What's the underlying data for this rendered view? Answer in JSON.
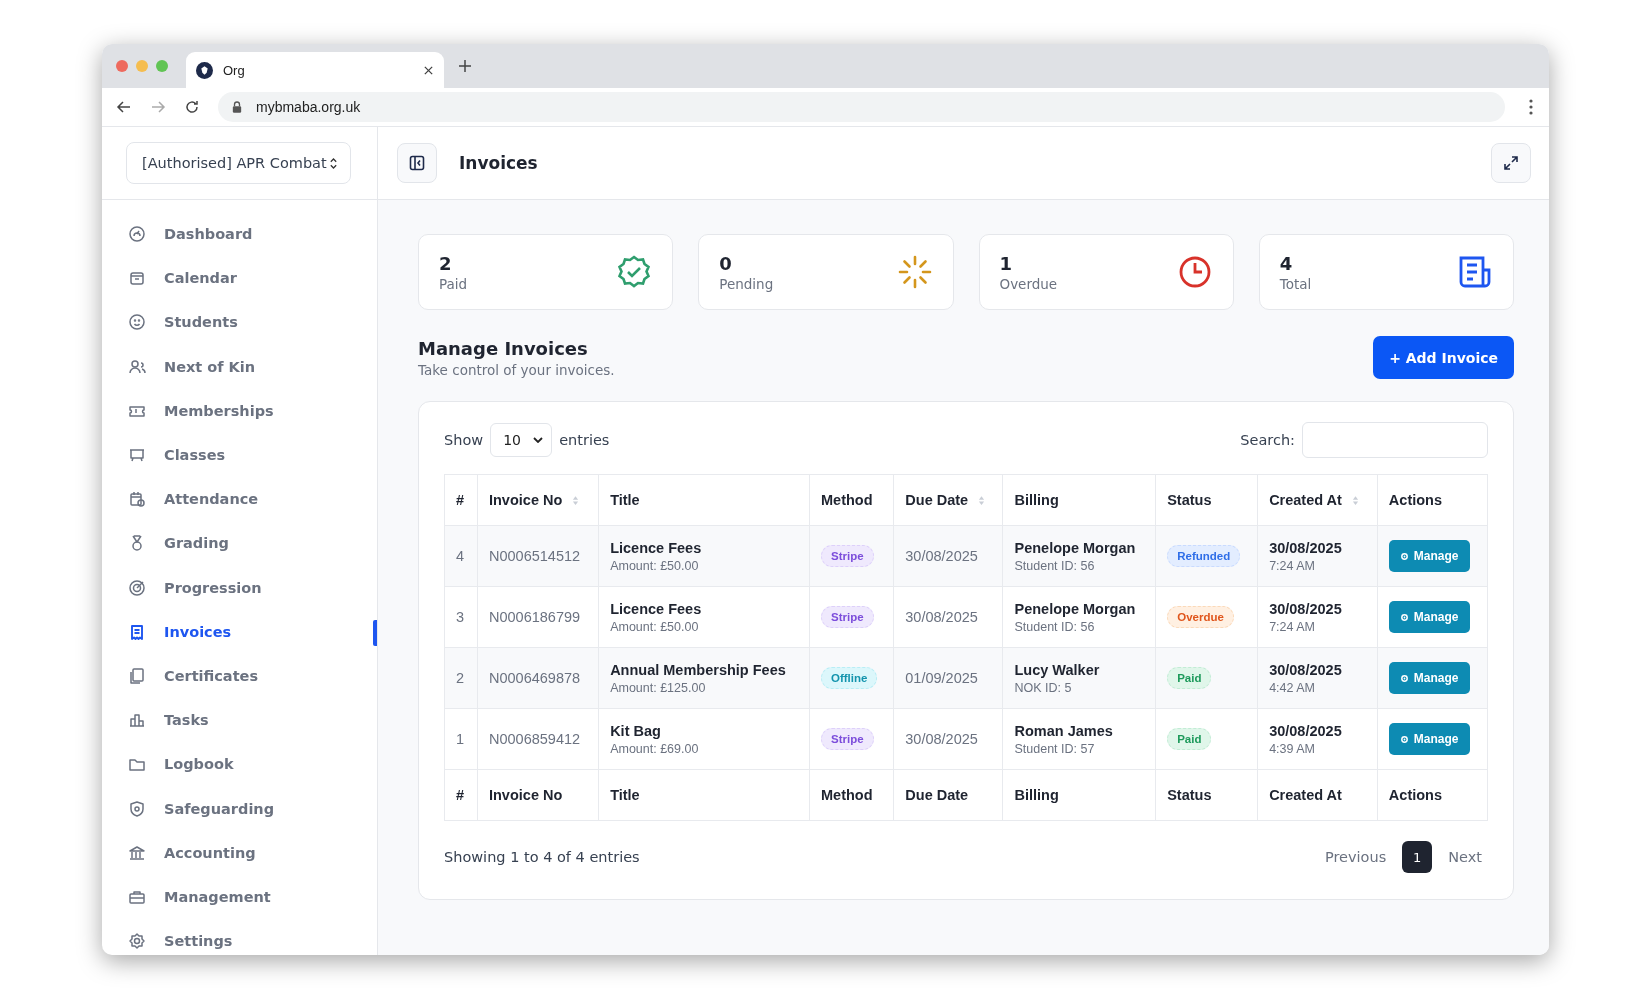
{
  "browser": {
    "tab_title": "Org",
    "url": "mybmaba.org.uk"
  },
  "sidebar": {
    "org_selector": "[Authorised] APR Combat",
    "items": [
      {
        "label": "Dashboard",
        "selected": false
      },
      {
        "label": "Calendar",
        "selected": false
      },
      {
        "label": "Students",
        "selected": false
      },
      {
        "label": "Next of Kin",
        "selected": false
      },
      {
        "label": "Memberships",
        "selected": false
      },
      {
        "label": "Classes",
        "selected": false
      },
      {
        "label": "Attendance",
        "selected": false
      },
      {
        "label": "Grading",
        "selected": false
      },
      {
        "label": "Progression",
        "selected": false
      },
      {
        "label": "Invoices",
        "selected": true
      },
      {
        "label": "Certificates",
        "selected": false
      },
      {
        "label": "Tasks",
        "selected": false
      },
      {
        "label": "Logbook",
        "selected": false
      },
      {
        "label": "Safeguarding",
        "selected": false
      },
      {
        "label": "Accounting",
        "selected": false
      },
      {
        "label": "Management",
        "selected": false
      },
      {
        "label": "Settings",
        "selected": false
      }
    ]
  },
  "header": {
    "title": "Invoices"
  },
  "stats": [
    {
      "value": "2",
      "label": "Paid",
      "kind": "paid"
    },
    {
      "value": "0",
      "label": "Pending",
      "kind": "pending"
    },
    {
      "value": "1",
      "label": "Overdue",
      "kind": "overdue"
    },
    {
      "value": "4",
      "label": "Total",
      "kind": "total"
    }
  ],
  "section": {
    "title": "Manage Invoices",
    "subtitle": "Take control of your invoices.",
    "add_button": "+ Add Invoice"
  },
  "table_controls": {
    "show_label": "Show",
    "page_size": "10",
    "entries_label": "entries",
    "search_label": "Search:"
  },
  "table": {
    "columns": [
      {
        "label": "#",
        "sortable": false
      },
      {
        "label": "Invoice No",
        "sortable": true
      },
      {
        "label": "Title",
        "sortable": false
      },
      {
        "label": "Method",
        "sortable": false
      },
      {
        "label": "Due Date",
        "sortable": true
      },
      {
        "label": "Billing",
        "sortable": false
      },
      {
        "label": "Status",
        "sortable": false
      },
      {
        "label": "Created At",
        "sortable": true
      },
      {
        "label": "Actions",
        "sortable": false
      }
    ],
    "rows": [
      {
        "num": "4",
        "invoice_no": "N0006514512",
        "title": "Licence Fees",
        "amount": "Amount: £50.00",
        "method": {
          "label": "Stripe",
          "kind": "stripe"
        },
        "due_date": "30/08/2025",
        "billing_name": "Penelope Morgan",
        "billing_id": "Student ID: 56",
        "status": {
          "label": "Refunded",
          "kind": "refunded"
        },
        "created_date": "30/08/2025",
        "created_time": "7:24 AM",
        "action": "Manage"
      },
      {
        "num": "3",
        "invoice_no": "N0006186799",
        "title": "Licence Fees",
        "amount": "Amount: £50.00",
        "method": {
          "label": "Stripe",
          "kind": "stripe"
        },
        "due_date": "30/08/2025",
        "billing_name": "Penelope Morgan",
        "billing_id": "Student ID: 56",
        "status": {
          "label": "Overdue",
          "kind": "overdue"
        },
        "created_date": "30/08/2025",
        "created_time": "7:24 AM",
        "action": "Manage"
      },
      {
        "num": "2",
        "invoice_no": "N0006469878",
        "title": "Annual Membership Fees",
        "amount": "Amount: £125.00",
        "method": {
          "label": "Offline",
          "kind": "offline"
        },
        "due_date": "01/09/2025",
        "billing_name": "Lucy Walker",
        "billing_id": "NOK ID: 5",
        "status": {
          "label": "Paid",
          "kind": "paid"
        },
        "created_date": "30/08/2025",
        "created_time": "4:42 AM",
        "action": "Manage"
      },
      {
        "num": "1",
        "invoice_no": "N0006859412",
        "title": "Kit Bag",
        "amount": "Amount: £69.00",
        "method": {
          "label": "Stripe",
          "kind": "stripe"
        },
        "due_date": "30/08/2025",
        "billing_name": "Roman James",
        "billing_id": "Student ID: 57",
        "status": {
          "label": "Paid",
          "kind": "paid"
        },
        "created_date": "30/08/2025",
        "created_time": "4:39 AM",
        "action": "Manage"
      }
    ],
    "footer_columns": [
      "#",
      "Invoice No",
      "Title",
      "Method",
      "Due Date",
      "Billing",
      "Status",
      "Created At",
      "Actions"
    ]
  },
  "pagination": {
    "info": "Showing 1 to 4 of 4 entries",
    "previous": "Previous",
    "pages": [
      {
        "label": "1",
        "selected": true
      }
    ],
    "next": "Next"
  }
}
